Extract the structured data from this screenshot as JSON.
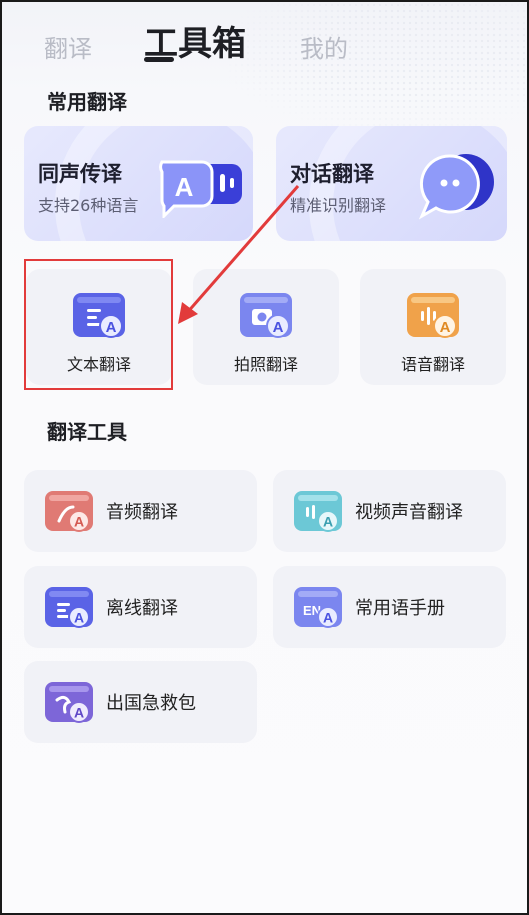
{
  "tabs": [
    {
      "label": "翻译",
      "active": false
    },
    {
      "label": "工具箱",
      "active": true
    },
    {
      "label": "我的",
      "active": false
    }
  ],
  "sections": {
    "common": {
      "title": "常用翻译"
    },
    "tools": {
      "title": "翻译工具"
    }
  },
  "hero_cards": [
    {
      "title": "同声传译",
      "subtitle": "支持26种语言",
      "icon": "speech-bubble-a-icon"
    },
    {
      "title": "对话翻译",
      "subtitle": "精准识别翻译",
      "icon": "chat-bubble-icon"
    }
  ],
  "tiles": [
    {
      "label": "文本翻译",
      "icon": "text-translate-icon"
    },
    {
      "label": "拍照翻译",
      "icon": "camera-translate-icon"
    },
    {
      "label": "语音翻译",
      "icon": "voice-translate-icon"
    }
  ],
  "tools": [
    {
      "label": "音频翻译",
      "icon": "audio-translate-icon"
    },
    {
      "label": "视频声音翻译",
      "icon": "video-translate-icon"
    },
    {
      "label": "离线翻译",
      "icon": "offline-translate-icon"
    },
    {
      "label": "常用语手册",
      "icon": "phrasebook-icon"
    },
    {
      "label": "出国急救包",
      "icon": "travel-kit-icon"
    }
  ],
  "colors": {
    "annotation_red": "#e23b3b",
    "accent_blue": "#4a52e0",
    "accent_orange": "#f0a24a",
    "accent_red": "#e07a74",
    "accent_teal": "#6cc8d6",
    "accent_purple": "#7d66d8"
  }
}
